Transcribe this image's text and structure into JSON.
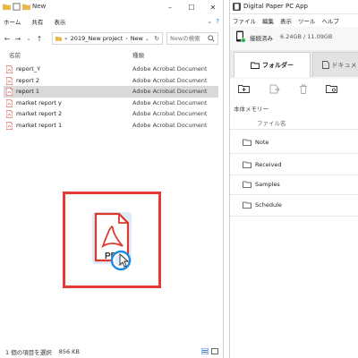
{
  "explorer": {
    "title": "New",
    "ribbon": {
      "home": "ホーム",
      "share": "共有",
      "view": "表示"
    },
    "address": {
      "crumb1": "2019_New project",
      "crumb2": "New",
      "search_placeholder": "Newの検索"
    },
    "columns": {
      "name": "名前",
      "type": "種類"
    },
    "files": [
      {
        "name": "report_Y",
        "type": "Adobe Acrobat Document",
        "selected": false
      },
      {
        "name": "report 2",
        "type": "Adobe Acrobat Document",
        "selected": false
      },
      {
        "name": "report 1",
        "type": "Adobe Acrobat Document",
        "selected": true
      },
      {
        "name": "market report y",
        "type": "Adobe Acrobat Document",
        "selected": false
      },
      {
        "name": "market report 2",
        "type": "Adobe Acrobat Document",
        "selected": false
      },
      {
        "name": "market report 1",
        "type": "Adobe Acrobat Document",
        "selected": false
      }
    ],
    "status": {
      "count": "1 個の項目を選択",
      "size": "856 KB"
    },
    "drag_label": "PDF"
  },
  "digital_paper": {
    "title": "Digital Paper PC App",
    "menu": [
      "ファイル",
      "編集",
      "表示",
      "ツール",
      "ヘルプ"
    ],
    "connection": "接続済み",
    "storage": "6.24GB / 11.09GB",
    "tabs": {
      "folder": "フォルダー",
      "documents": "ドキュメ"
    },
    "memory_label": "本体メモリー",
    "file_name_header": "ファイル名",
    "folders": [
      "Note",
      "Received",
      "Samples",
      "Schedule"
    ]
  },
  "colors": {
    "accent_red": "#e53935",
    "pdf_red": "#d93a2b",
    "connected_green": "#2db84d",
    "highlight_blue": "#1e88e5"
  }
}
